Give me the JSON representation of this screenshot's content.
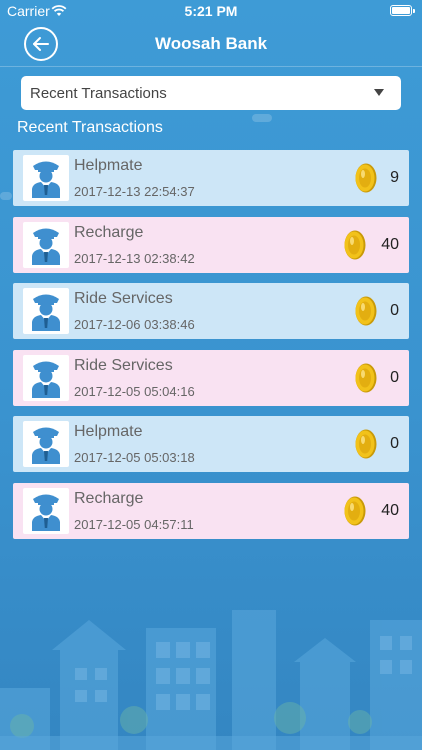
{
  "status": {
    "carrier": "Carrier",
    "time": "5:21 PM"
  },
  "nav": {
    "title": "Woosah Bank",
    "back_icon": "back-arrow-icon"
  },
  "filter": {
    "selected": "Recent Transactions"
  },
  "section_title": "Recent Transactions",
  "transactions": [
    {
      "title": "Helpmate",
      "date": "2017-12-13 22:54:37",
      "amount": "9",
      "style": "blue"
    },
    {
      "title": "Recharge",
      "date": "2017-12-13 02:38:42",
      "amount": "40",
      "style": "pink"
    },
    {
      "title": "Ride Services",
      "date": "2017-12-06 03:38:46",
      "amount": "0",
      "style": "blue"
    },
    {
      "title": "Ride Services",
      "date": "2017-12-05 05:04:16",
      "amount": "0",
      "style": "pink"
    },
    {
      "title": "Helpmate",
      "date": "2017-12-05 05:03:18",
      "amount": "0",
      "style": "blue"
    },
    {
      "title": "Recharge",
      "date": "2017-12-05 04:57:11",
      "amount": "40",
      "style": "pink"
    }
  ],
  "colors": {
    "background": "#3e9bd6",
    "row_blue": "#cde6f7",
    "row_pink": "#f9e2f2",
    "coin": "#f2c21a",
    "avatar": "#3f8fcf"
  }
}
